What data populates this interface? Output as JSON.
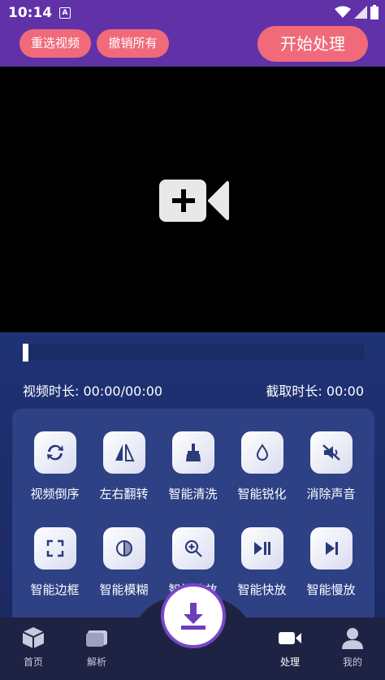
{
  "status": {
    "time": "10:14",
    "indicator": "A"
  },
  "toolbar": {
    "reselect_label": "重选视频",
    "undo_label": "撤销所有",
    "start_label": "开始处理"
  },
  "video": {
    "placeholder_icon": "video-add-icon"
  },
  "progress": {
    "value": 0
  },
  "duration": {
    "video_text": "视频时长: 00:00/00:00",
    "clip_text": "截取时长: 00:00"
  },
  "tools": [
    {
      "label": "视频倒序",
      "icon": "reverse-icon"
    },
    {
      "label": "左右翻转",
      "icon": "flip-icon"
    },
    {
      "label": "智能清洗",
      "icon": "broom-icon"
    },
    {
      "label": "智能锐化",
      "icon": "drop-icon"
    },
    {
      "label": "消除声音",
      "icon": "mute-icon"
    },
    {
      "label": "智能边框",
      "icon": "frame-icon"
    },
    {
      "label": "智能模糊",
      "icon": "blur-icon"
    },
    {
      "label": "智能缩放",
      "icon": "zoom-icon"
    },
    {
      "label": "智能快放",
      "icon": "fast-play-icon"
    },
    {
      "label": "智能慢放",
      "icon": "slow-play-icon"
    }
  ],
  "nav": {
    "home": "首页",
    "parse": "解析",
    "process": "处理",
    "mine": "我的"
  },
  "colors": {
    "topbar": "#6131a8",
    "pill": "#f06a7a",
    "panel": "#1f3274",
    "card": "#2d4184",
    "nav": "#1e2343",
    "fab_ring": "#7a45c8"
  }
}
